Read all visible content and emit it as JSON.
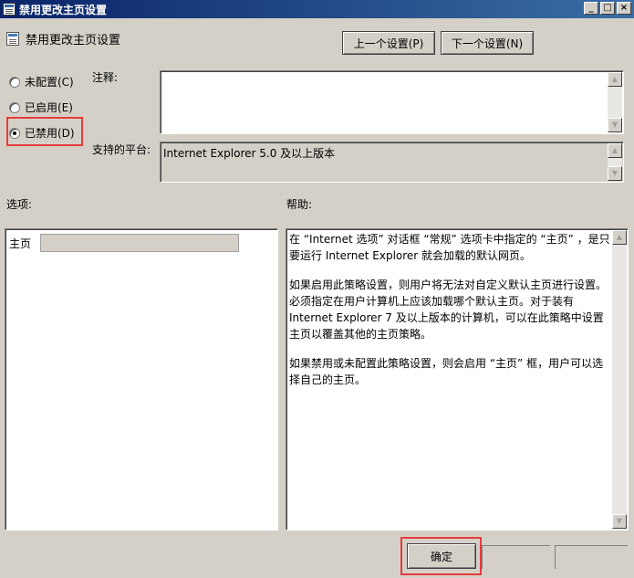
{
  "window": {
    "title": "禁用更改主页设置",
    "minimize": "_",
    "maximize": "□",
    "close": "×"
  },
  "header": {
    "policy_title": "禁用更改主页设置",
    "prev_button": "上一个设置(P)",
    "next_button": "下一个设置(N)"
  },
  "state": {
    "options": [
      {
        "label": "未配置(C)",
        "checked": false
      },
      {
        "label": "已启用(E)",
        "checked": false
      },
      {
        "label": "已禁用(D)",
        "checked": true
      }
    ]
  },
  "comment": {
    "label": "注释:",
    "value": ""
  },
  "platform": {
    "label": "支持的平台:",
    "value": "Internet Explorer 5.0 及以上版本"
  },
  "options_pane": {
    "label": "选项:",
    "homepage_label": "主页",
    "homepage_value": ""
  },
  "help_pane": {
    "label": "帮助:",
    "paragraphs": [
      "在 “Internet 选项” 对话框 “常规” 选项卡中指定的 “主页” ，是只要运行 Internet Explorer 就会加载的默认网页。",
      "如果启用此策略设置，则用户将无法对自定义默认主页进行设置。必须指定在用户计算机上应该加载哪个默认主页。对于装有 Internet Explorer 7 及以上版本的计算机，可以在此策略中设置主页以覆盖其他的主页策略。",
      "如果禁用或未配置此策略设置，则会启用 “主页” 框，用户可以选择自己的主页。"
    ]
  },
  "footer": {
    "ok_button": "确定"
  },
  "icons": {
    "scroll_up": "▲",
    "scroll_down": "▼"
  },
  "colors": {
    "highlight_box": "#e63b3b",
    "titlebar": "#0a246a"
  }
}
